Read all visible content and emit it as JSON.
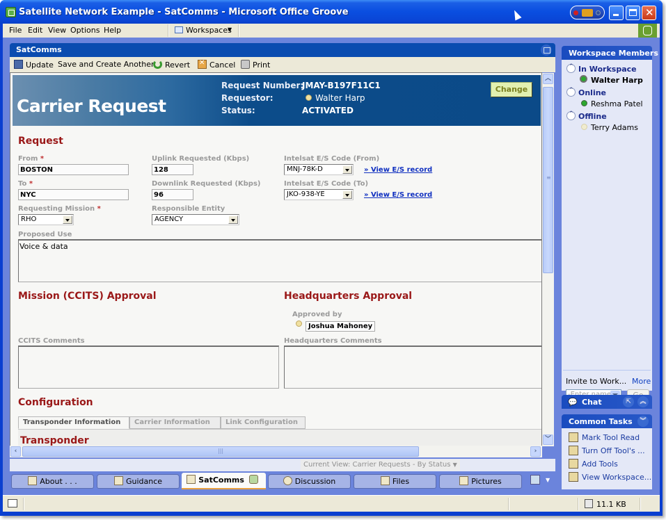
{
  "window": {
    "title": "Satellite Network Example - SatComms - Microsoft Office Groove"
  },
  "menu": {
    "items": [
      "File",
      "Edit",
      "View",
      "Options",
      "Help"
    ],
    "workspaces_label": "Workspaces"
  },
  "tool": {
    "title": "SatComms",
    "toolbar": {
      "update": "Update",
      "save_create": "Save and Create Another",
      "revert": "Revert",
      "cancel": "Cancel",
      "print": "Print"
    }
  },
  "banner": {
    "title": "Carrier Request",
    "request_number_label": "Request Number:",
    "request_number": "JMAY-B197F11C1",
    "requestor_label": "Requestor:",
    "requestor": "Walter Harp",
    "status_label": "Status:",
    "status": "ACTIVATED",
    "change_button": "Change"
  },
  "request": {
    "section_title": "Request",
    "from_label": "From",
    "from_value": "BOSTON",
    "to_label": "To",
    "to_value": "NYC",
    "uplink_label": "Uplink Requested (Kbps)",
    "uplink_value": "128",
    "downlink_label": "Downlink Requested (Kbps)",
    "downlink_value": "96",
    "es_from_label": "Intelsat E/S Code (From)",
    "es_from_value": "MNJ-78K-D",
    "es_to_label": "Intelsat E/S Code (To)",
    "es_to_value": "JKO-938-YE",
    "view_es_link": "» View E/S record",
    "mission_label": "Requesting Mission",
    "mission_value": "RHO",
    "entity_label": "Responsible Entity",
    "entity_value": "AGENCY",
    "proposed_use_label": "Proposed Use",
    "proposed_use_value": "Voice & data",
    "required_marker": "*"
  },
  "approval": {
    "mission_title": "Mission (CCITS) Approval",
    "hq_title": "Headquarters Approval",
    "approved_by_label": "Approved by",
    "approved_by": "Joshua Mahoney",
    "ccits_comments_label": "CCITS Comments",
    "hq_comments_label": "Headquarters Comments",
    "ccits_comments_value": "",
    "hq_comments_value": ""
  },
  "configuration": {
    "section_title": "Configuration",
    "tabs": [
      "Transponder Information",
      "Carrier Information",
      "Link Configuration"
    ],
    "active_tab": "Transponder Information",
    "subsection_title": "Transponder"
  },
  "view": {
    "current_view": "Current View: Carrier Requests - By Status"
  },
  "bottom_tabs": [
    {
      "label": "About . . ."
    },
    {
      "label": "Guidance"
    },
    {
      "label": "SatComms",
      "active": true
    },
    {
      "label": "Discussion"
    },
    {
      "label": "Files"
    },
    {
      "label": "Pictures"
    }
  ],
  "side": {
    "members_title": "Workspace Members",
    "groups": [
      {
        "label": "In Workspace",
        "members": [
          {
            "name": "Walter Harp",
            "status": "in-workspace"
          }
        ]
      },
      {
        "label": "Online",
        "members": [
          {
            "name": "Reshma Patel",
            "status": "online"
          }
        ]
      },
      {
        "label": "Offline",
        "members": [
          {
            "name": "Terry Adams",
            "status": "offline"
          }
        ]
      }
    ],
    "invite_label": "Invite to Work...",
    "more_link": "More",
    "invite_placeholder": "-Enter name",
    "go_button": "Go",
    "chat_title": "Chat",
    "tasks_title": "Common Tasks",
    "tasks": [
      "Mark Tool Read",
      "Turn Off Tool's ...",
      "Add Tools",
      "View Workspace..."
    ]
  },
  "statusbar": {
    "size": "11.1 KB"
  },
  "colors": {
    "accent_title": "#9a1818",
    "banner_blue": "#0b4a88",
    "link": "#1030c0",
    "online_green": "#2ca830"
  }
}
